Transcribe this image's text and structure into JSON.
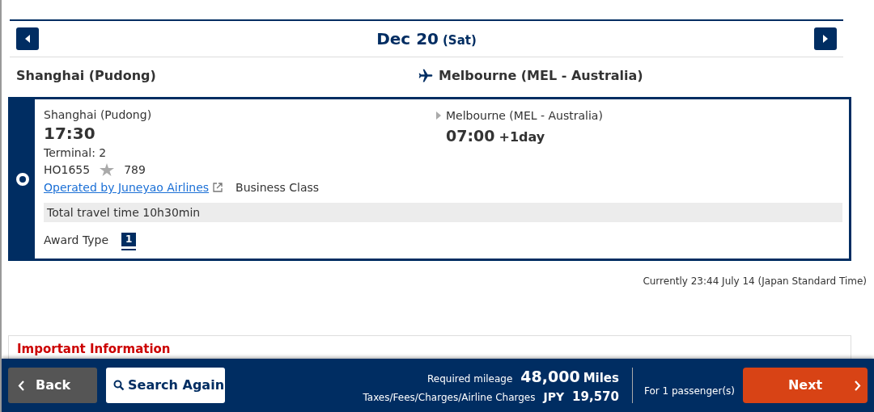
{
  "date_nav": {
    "date": "Dec 20",
    "weekday": "(Sat)"
  },
  "route": {
    "origin": "Shanghai (Pudong)",
    "destination": "Melbourne (MEL - Australia)"
  },
  "flights": [
    {
      "selected": true,
      "departure_airport": "Shanghai (Pudong)",
      "departure_time": "17:30",
      "terminal": "Terminal: 2",
      "flight_number": "HO1655",
      "aircraft": "789",
      "operator_link": "Operated by Juneyao Airlines",
      "cabin": "Business Class",
      "arrival_airport": "Melbourne (MEL - Australia)",
      "arrival_time": "07:00",
      "day_offset": "+1day",
      "travel_time": "Total travel time 10h30min",
      "award_type_label": "Award Type",
      "award_type": "1"
    }
  ],
  "current_time": "Currently 23:44 July 14 (Japan Standard Time)",
  "important_info_title": "Important Information",
  "footer": {
    "back": "Back",
    "search_again": "Search Again",
    "mileage_label": "Required mileage",
    "mileage_value": "48,000",
    "mileage_unit": "Miles",
    "taxes_label": "Taxes/Fees/Charges/Airline Charges",
    "currency": "JPY",
    "taxes_value": "19,570",
    "passengers": "For 1 passenger(s)",
    "next": "Next"
  }
}
